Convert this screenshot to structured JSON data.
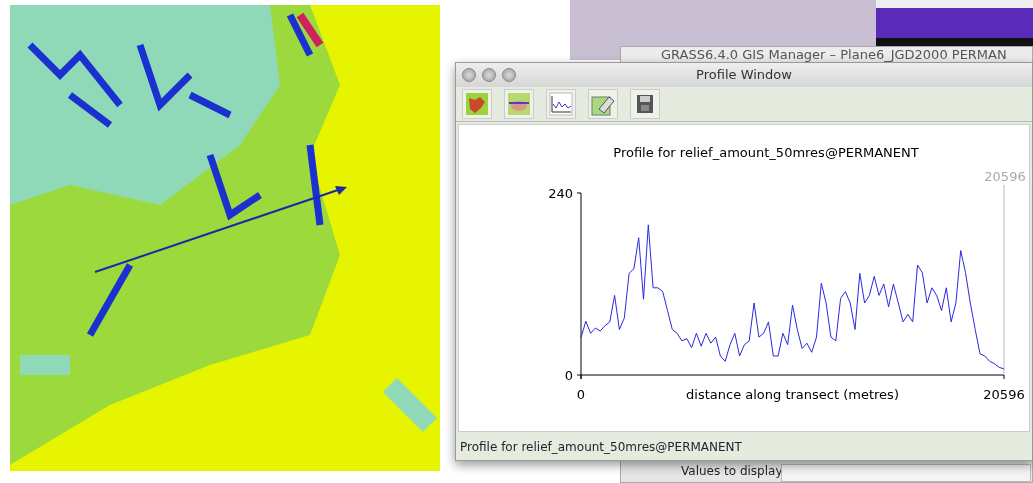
{
  "background_window": {
    "title": "GRASS6.4.0 GIS Manager – Plane6_JGD2000 PERMAN",
    "label": "Values to display"
  },
  "profile_window": {
    "title": "Profile Window",
    "toolbar": [
      {
        "kind": "map"
      },
      {
        "kind": "map-line"
      },
      {
        "kind": "chart"
      },
      {
        "kind": "eraser"
      },
      {
        "kind": "save"
      }
    ],
    "chart_data": {
      "type": "line",
      "title": "Profile for relief_amount_50mres@PERMANENT",
      "xlabel": "distance along transect (metres)",
      "xlim": [
        0,
        20596
      ],
      "ylim": [
        0,
        240
      ],
      "xticks": [
        0,
        20596
      ],
      "yticks": [
        0,
        240
      ],
      "annotations": [
        "20596"
      ],
      "x": [
        0,
        234,
        468,
        702,
        936,
        1170,
        1404,
        1638,
        1872,
        2106,
        2341,
        2575,
        2809,
        3043,
        3277,
        3511,
        3745,
        3979,
        4213,
        4447,
        4681,
        4915,
        5149,
        5383,
        5617,
        5851,
        6085,
        6319,
        6553,
        6787,
        7021,
        7255,
        7489,
        7723,
        7958,
        8192,
        8426,
        8660,
        8894,
        9128,
        9362,
        9596,
        9830,
        10064,
        10298,
        10532,
        10766,
        11000,
        11234,
        11468,
        11702,
        11936,
        12170,
        12404,
        12638,
        12872,
        13106,
        13340,
        13575,
        13809,
        14043,
        14277,
        14511,
        14745,
        14979,
        15213,
        15447,
        15681,
        15915,
        16149,
        16383,
        16617,
        16851,
        17085,
        17319,
        17553,
        17787,
        18021,
        18255,
        18489,
        18723,
        18957,
        19192,
        19426,
        19660,
        19894,
        20128,
        20362,
        20596
      ],
      "series": [
        {
          "color": "#2a2ae0",
          "values": [
            49,
            71,
            55,
            62,
            58,
            65,
            70,
            105,
            60,
            75,
            134,
            140,
            181,
            100,
            198,
            115,
            115,
            110,
            85,
            60,
            55,
            45,
            48,
            36,
            55,
            38,
            55,
            42,
            50,
            25,
            18,
            40,
            55,
            25,
            40,
            45,
            95,
            50,
            55,
            70,
            25,
            25,
            55,
            40,
            92,
            60,
            35,
            42,
            30,
            50,
            121,
            95,
            50,
            45,
            101,
            110,
            95,
            60,
            134,
            95,
            105,
            130,
            105,
            120,
            90,
            120,
            95,
            70,
            80,
            70,
            145,
            135,
            95,
            115,
            105,
            85,
            115,
            70,
            95,
            164,
            135,
            95,
            60,
            28,
            25,
            18,
            15,
            10,
            8
          ]
        }
      ]
    },
    "status_bar": "Profile for relief_amount_50mres@PERMANENT"
  }
}
